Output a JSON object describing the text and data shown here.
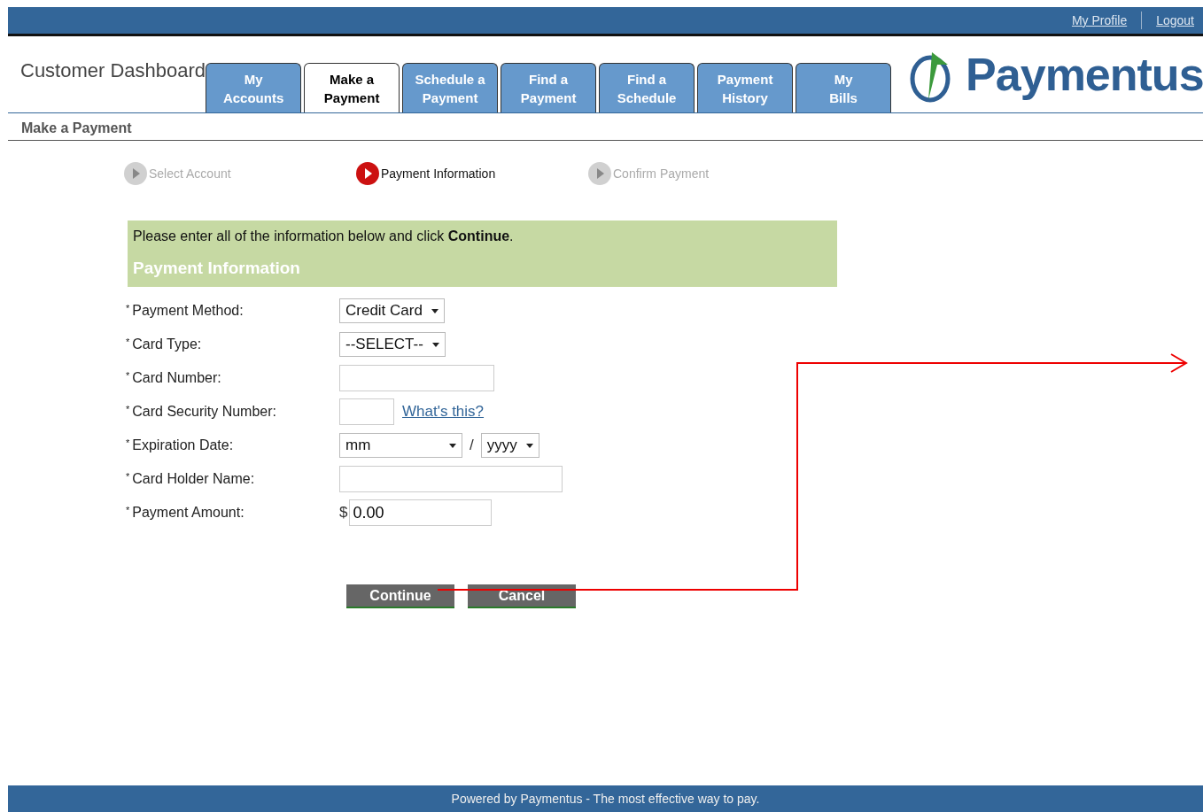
{
  "top_links": [
    "My Profile",
    "Logout"
  ],
  "header": {
    "title": "Customer Dashboard",
    "logo_text": "Paymentus"
  },
  "tabs": [
    {
      "line1": "My",
      "line2": "Accounts",
      "selected": false
    },
    {
      "line1": "Make a",
      "line2": "Payment",
      "selected": true
    },
    {
      "line1": "Schedule a",
      "line2": "Payment",
      "selected": false
    },
    {
      "line1": "Find a",
      "line2": "Payment",
      "selected": false
    },
    {
      "line1": "Find a",
      "line2": "Schedule",
      "selected": false
    },
    {
      "line1": "Payment",
      "line2": "History",
      "selected": false
    },
    {
      "line1": "My",
      "line2": "Bills",
      "selected": false
    }
  ],
  "section_title": "Make a Payment",
  "steps": [
    {
      "label": "Select Account",
      "selected": false
    },
    {
      "label": "Payment Information",
      "selected": true
    },
    {
      "label": "Confirm Payment",
      "selected": false
    }
  ],
  "notice": {
    "text": "Please enter all of the information below and click **Continue**.",
    "heading": "Payment Information"
  },
  "fields": [
    {
      "kind": "select",
      "mark": "*",
      "label": "Payment Method:",
      "value": "Credit Card"
    },
    {
      "kind": "select",
      "mark": "*",
      "label": "Card Type:",
      "value": "--SELECT--"
    },
    {
      "kind": "input",
      "mark": "*",
      "label": "Card Number:"
    },
    {
      "kind": "short_input",
      "mark": "*",
      "label": "Card Security Number:",
      "link": "What's this?"
    },
    {
      "kind": "date",
      "mark": "*",
      "label": "Expiration Date:",
      "month": "mm",
      "separator": "/",
      "year": "yyyy"
    },
    {
      "kind": "input",
      "mark": "*",
      "label": "Card Holder Name:"
    },
    {
      "kind": "amount",
      "mark": "*",
      "label": "Payment Amount:",
      "currency": "$",
      "value": "0.00"
    }
  ],
  "buttons": [
    "Continue",
    "Cancel"
  ],
  "footer": "Powered by Paymentus - The most effective way to pay."
}
